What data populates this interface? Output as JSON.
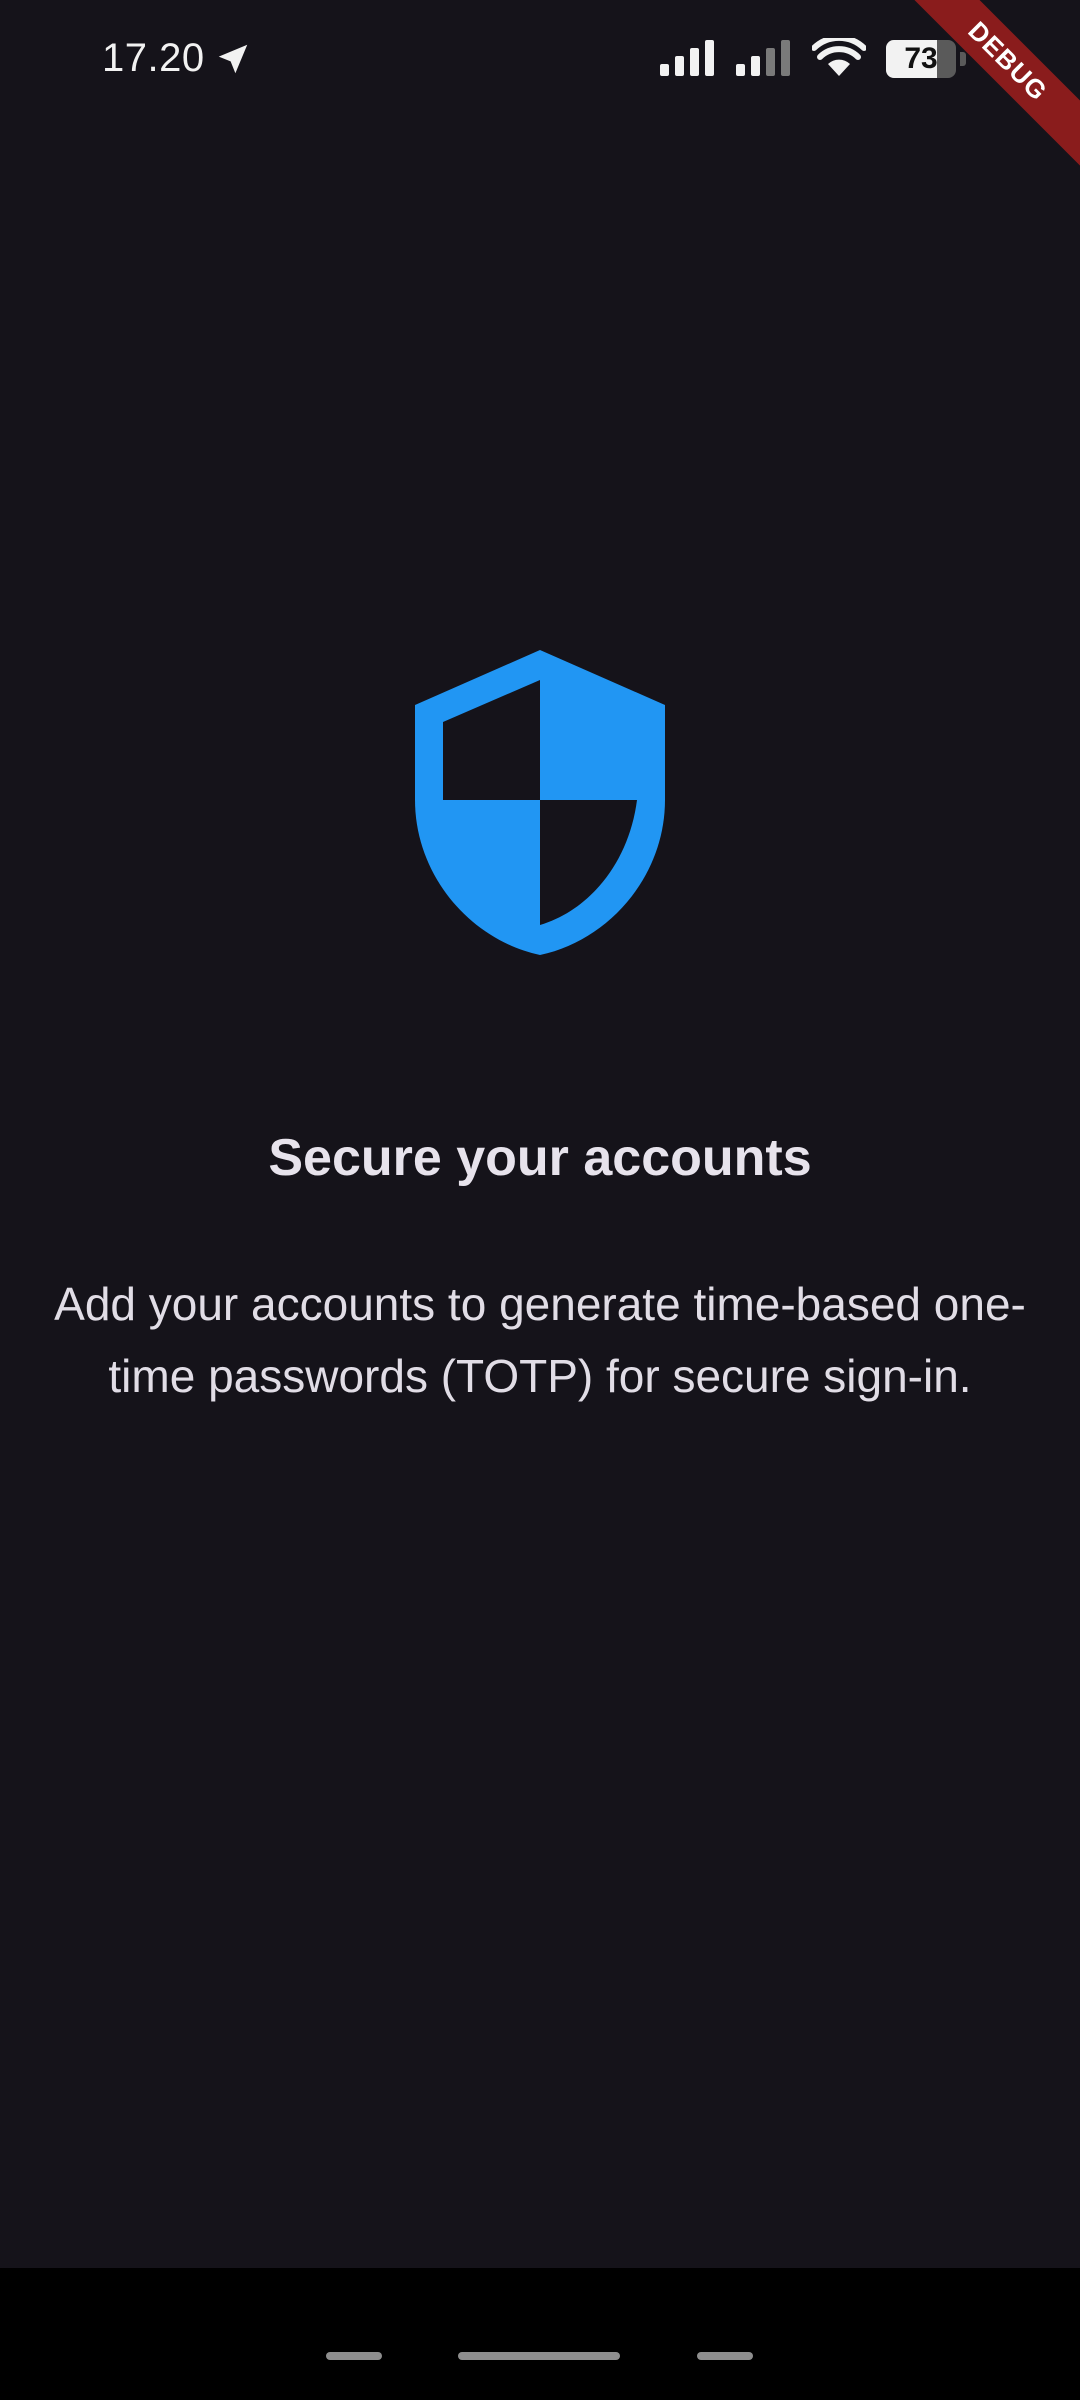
{
  "status_bar": {
    "time": "17.20",
    "battery_level": "73",
    "battery_fraction": 0.73
  },
  "debug_banner": {
    "label": "DEBUG"
  },
  "icons": {
    "location": "location-arrow-icon",
    "signal": "cell-signal-icon",
    "wifi": "wifi-icon",
    "battery": "battery-icon",
    "hero": "shield-icon"
  },
  "colors": {
    "background": "#15131a",
    "accent": "#2196f3",
    "debug": "#8a1c1c",
    "nav_bar": "#000000"
  },
  "empty_state": {
    "title": "Secure your accounts",
    "body": "Add your accounts to generate time-based one-time passwords (TOTP) for secure sign-in."
  }
}
